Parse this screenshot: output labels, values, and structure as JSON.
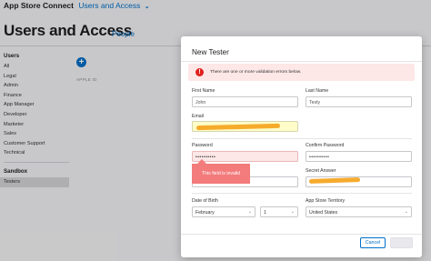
{
  "header": {
    "app_title": "App Store Connect",
    "section": "Users and Access",
    "page_title": "Users and Access",
    "tab_people": "People"
  },
  "sidebar": {
    "users_heading": "Users",
    "items": [
      "All",
      "Legal",
      "Admin",
      "Finance",
      "App Manager",
      "Developer",
      "Marketer",
      "Sales",
      "Customer Support",
      "Technical"
    ],
    "sandbox_heading": "Sandbox",
    "sandbox_items": [
      "Testers"
    ]
  },
  "table": {
    "apple_id_header": "APPLE ID"
  },
  "modal": {
    "title": "New Tester",
    "alert_text": "There are one or more validation errors below.",
    "first_name_label": "First Name",
    "first_name_value": "John",
    "last_name_label": "Last Name",
    "last_name_value": "Testy",
    "email_label": "Email",
    "password_label": "Password",
    "password_value": "••••••••••",
    "confirm_password_label": "Confirm Password",
    "confirm_password_value": "••••••••••",
    "tooltip": "This field is invalid",
    "secret_answer_label": "Secret Answer",
    "dob_label": "Date of Birth",
    "dob_month": "February",
    "dob_day": "1",
    "territory_label": "App Store Territory",
    "territory_value": "United States",
    "cancel_label": "Cancel",
    "create_label": "Create"
  },
  "colors": {
    "accent": "#0070c9",
    "error": "#e0201e",
    "tooltip": "#f37b7b",
    "redaction": "#f5a623"
  }
}
